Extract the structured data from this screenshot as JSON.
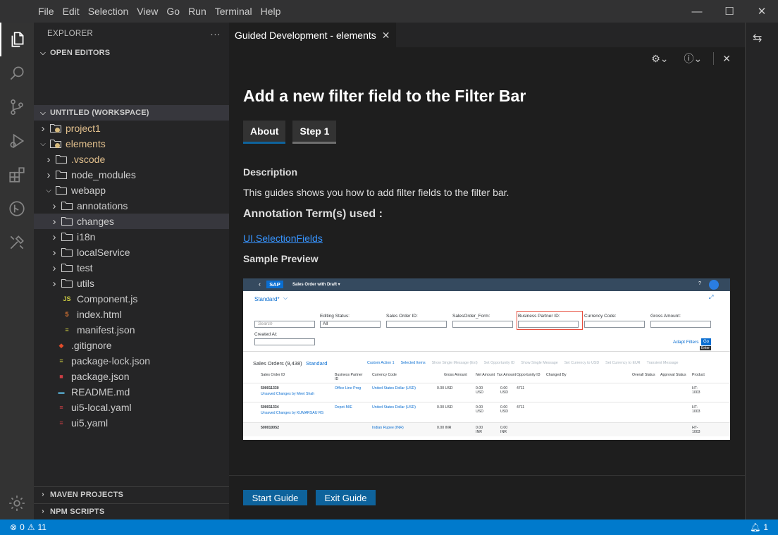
{
  "menu": [
    "File",
    "Edit",
    "Selection",
    "View",
    "Go",
    "Run",
    "Terminal",
    "Help"
  ],
  "window_controls": {
    "minimize": "—",
    "maximize": "☐",
    "close": "✕"
  },
  "explorer": {
    "title": "EXPLORER",
    "more": "···",
    "open_editors": "OPEN EDITORS",
    "workspace": "UNTITLED (WORKSPACE)",
    "maven": "MAVEN PROJECTS",
    "npm": "NPM SCRIPTS"
  },
  "tree": [
    {
      "label": "project1",
      "depth": 0,
      "kind": "folder",
      "open": false,
      "color": "gold",
      "badge": true
    },
    {
      "label": "elements",
      "depth": 0,
      "kind": "folder",
      "open": true,
      "color": "gold",
      "badge": true
    },
    {
      "label": ".vscode",
      "depth": 1,
      "kind": "folder",
      "open": false,
      "color": "gold"
    },
    {
      "label": "node_modules",
      "depth": 1,
      "kind": "folder",
      "open": false
    },
    {
      "label": "webapp",
      "depth": 1,
      "kind": "folder",
      "open": true
    },
    {
      "label": "annotations",
      "depth": 2,
      "kind": "folder",
      "open": false
    },
    {
      "label": "changes",
      "depth": 2,
      "kind": "folder",
      "open": false,
      "selected": true
    },
    {
      "label": "i18n",
      "depth": 2,
      "kind": "folder",
      "open": false
    },
    {
      "label": "localService",
      "depth": 2,
      "kind": "folder",
      "open": false
    },
    {
      "label": "test",
      "depth": 2,
      "kind": "folder",
      "open": false
    },
    {
      "label": "utils",
      "depth": 2,
      "kind": "folder",
      "open": false
    },
    {
      "label": "Component.js",
      "depth": 2,
      "kind": "file",
      "icon": "js-icon",
      "glyph": "JS",
      "iconColor": "#cbcb41"
    },
    {
      "label": "index.html",
      "depth": 2,
      "kind": "file",
      "icon": "html-icon",
      "glyph": "5",
      "iconColor": "#e37933"
    },
    {
      "label": "manifest.json",
      "depth": 2,
      "kind": "file",
      "icon": "json-icon",
      "glyph": "≡",
      "iconColor": "#cbcb41"
    },
    {
      "label": ".gitignore",
      "depth": 1,
      "kind": "file",
      "icon": "git-icon",
      "glyph": "◆",
      "iconColor": "#e44d2a"
    },
    {
      "label": "package-lock.json",
      "depth": 1,
      "kind": "file",
      "icon": "json-icon",
      "glyph": "≡",
      "iconColor": "#cbcb41"
    },
    {
      "label": "package.json",
      "depth": 1,
      "kind": "file",
      "icon": "npm-icon",
      "glyph": "■",
      "iconColor": "#cc3e44"
    },
    {
      "label": "README.md",
      "depth": 1,
      "kind": "file",
      "icon": "markdown-icon",
      "glyph": "▬",
      "iconColor": "#519aba"
    },
    {
      "label": "ui5-local.yaml",
      "depth": 1,
      "kind": "file",
      "icon": "yaml-icon",
      "glyph": "≡",
      "iconColor": "#cc3e44"
    },
    {
      "label": "ui5.yaml",
      "depth": 1,
      "kind": "file",
      "icon": "yaml-icon",
      "glyph": "≡",
      "iconColor": "#cc3e44"
    }
  ],
  "tab": {
    "label": "Guided Development - elements",
    "close": "✕"
  },
  "toolbar": {
    "settings": "⚙⌄",
    "info": "ⓘ⌄",
    "close": "✕"
  },
  "guide": {
    "title": "Add a new filter field to the Filter Bar",
    "tabs": [
      "About",
      "Step 1"
    ],
    "description_heading": "Description",
    "description": "This guides shows you how to add filter fields to the filter bar.",
    "annotation_heading": "Annotation Term(s) used :",
    "annotation_link": "UI.SelectionFields",
    "preview_heading": "Sample Preview"
  },
  "preview": {
    "app_title": "Sales Order with Draft ▾",
    "logo": "SAP",
    "variant": "Standard*",
    "filters": [
      "Editing Status:",
      "Sales Order ID:",
      "SalesOrder_Form:",
      "Business Partner ID:",
      "Currency Code:",
      "Gross Amount:"
    ],
    "search_placeholder": "Search",
    "editing_value": "All",
    "created_at": "Created At:",
    "adapt": "Adapt Filters",
    "go": "Go",
    "enter": "Enter",
    "table_title": "Sales Orders (9,438)",
    "table_variant": "Standard",
    "actions": [
      "Custom Action 1",
      "Selected Items",
      "Show Single Message (Ext)",
      "Set Opportunity ID",
      "Show Single Message",
      "Set Currency to USD",
      "Set Currency to EUR",
      "Transient Message"
    ],
    "columns": [
      "Sales Order ID",
      "Business Partner ID",
      "Currency Code",
      "Gross Amount",
      "Net Amount",
      "Tax Amount",
      "Opportunity ID",
      "Changed By",
      "Overall Status",
      "Approval Status",
      "Product"
    ],
    "rows": [
      {
        "id": "500011330",
        "sub": "Unsaved Changes by Meet Shah",
        "bp": "Office Line Prog",
        "cur": "United States Dollar (USD)",
        "gross": "0.00  USD",
        "net": "0.00 USD",
        "tax": "0.00 USD",
        "opp": "4711",
        "product": "HT-1003"
      },
      {
        "id": "500011334",
        "sub": "Unsaved Changes by KUMARSAU RS",
        "bp": "Depot-M/E",
        "cur": "United States Dollar (USD)",
        "gross": "0.00  USD",
        "net": "0.00 USD",
        "tax": "0.00 USD",
        "opp": "4711",
        "product": "HT-1003"
      },
      {
        "id": "500010052",
        "sub": "",
        "bp": "",
        "cur": "Indian Rupee (INR)",
        "gross": "0.00  INR",
        "net": "0.00 INR",
        "tax": "0.00 INR",
        "opp": "",
        "product": "HT-1003"
      }
    ]
  },
  "buttons": {
    "start": "Start Guide",
    "exit": "Exit Guide"
  },
  "status": {
    "errors": "0",
    "warnings": "11",
    "notifications": "1"
  }
}
